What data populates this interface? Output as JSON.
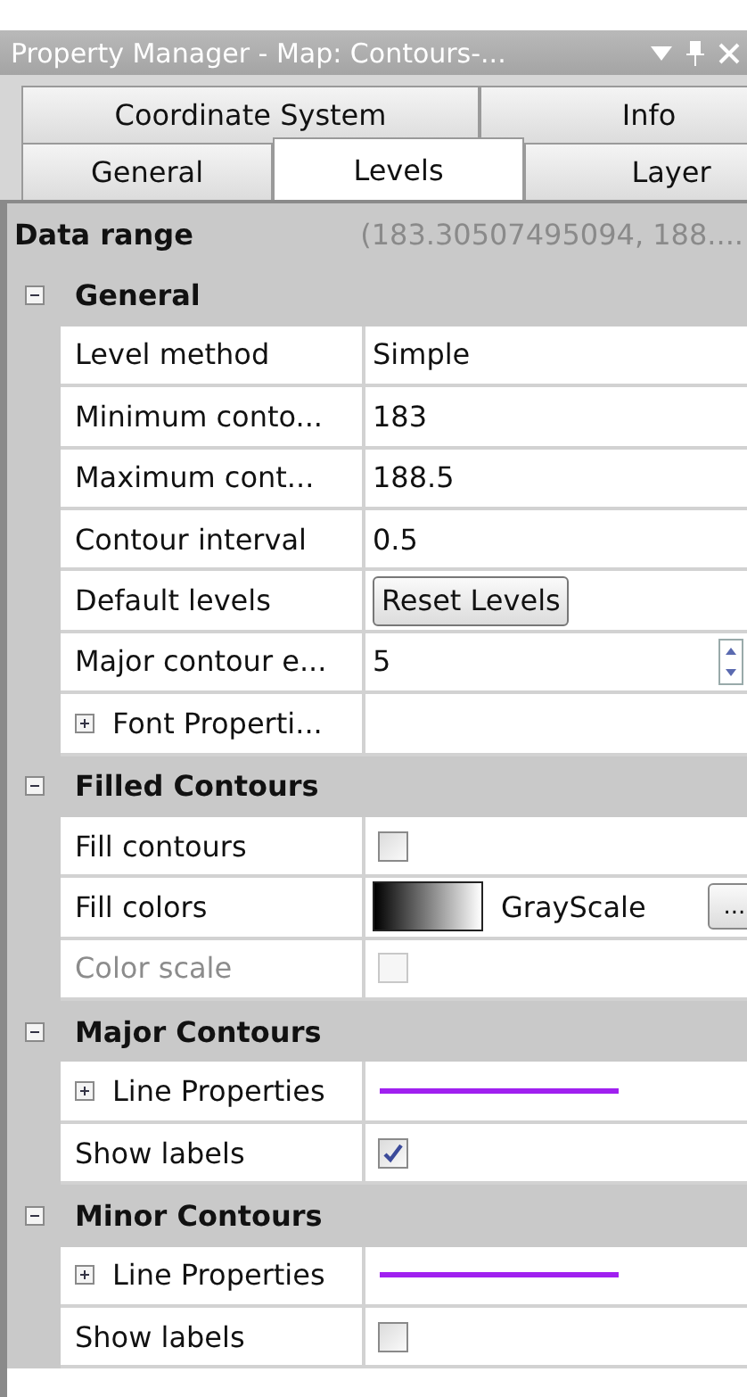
{
  "title": "Property Manager - Map: Contours-...",
  "tab_rows": [
    [
      {
        "label": "Coordinate System",
        "selected": false
      },
      {
        "label": "Info",
        "selected": false
      }
    ],
    [
      {
        "label": "General",
        "selected": false
      },
      {
        "label": "Levels",
        "selected": true
      },
      {
        "label": "Layer",
        "selected": false
      }
    ]
  ],
  "data_range": {
    "label": "Data range",
    "value": "(183.30507495094, 188...."
  },
  "sections": [
    {
      "title": "General",
      "expanded": true,
      "rows": [
        {
          "kind": "text",
          "label": "Level method",
          "value": "Simple"
        },
        {
          "kind": "text",
          "label": "Minimum conto...",
          "value": "183"
        },
        {
          "kind": "text",
          "label": "Maximum cont...",
          "value": "188.5"
        },
        {
          "kind": "text",
          "label": "Contour interval",
          "value": "0.5"
        },
        {
          "kind": "button",
          "label": "Default levels",
          "button": "Reset Levels"
        },
        {
          "kind": "spinner",
          "label": "Major contour e...",
          "value": "5"
        },
        {
          "kind": "group",
          "label": "Font Properti...",
          "expanded": false
        }
      ]
    },
    {
      "title": "Filled Contours",
      "expanded": true,
      "rows": [
        {
          "kind": "checkbox",
          "label": "Fill contours",
          "checked": false,
          "disabled": false
        },
        {
          "kind": "gradient",
          "label": "Fill colors",
          "value": "GrayScale",
          "button": "..."
        },
        {
          "kind": "checkbox",
          "label": "Color scale",
          "checked": false,
          "disabled": true
        }
      ]
    },
    {
      "title": "Major Contours",
      "expanded": true,
      "rows": [
        {
          "kind": "line",
          "label": "Line Properties",
          "expanded": false
        },
        {
          "kind": "checkbox",
          "label": "Show labels",
          "checked": true,
          "disabled": false
        }
      ]
    },
    {
      "title": "Minor Contours",
      "expanded": true,
      "rows": [
        {
          "kind": "line",
          "label": "Line Properties",
          "expanded": false
        },
        {
          "kind": "checkbox",
          "label": "Show labels",
          "checked": false,
          "disabled": false
        }
      ]
    }
  ]
}
